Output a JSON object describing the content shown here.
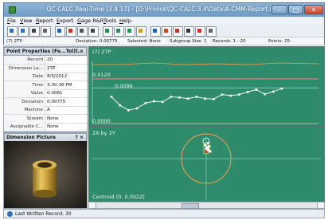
{
  "window": {
    "title": "QC-CALC Real-Time (3.4.17) - [D:\\Prolink\\QC-CALC 3.4\\Data\\A-CMM-Report.Qcc]",
    "min_label": "–",
    "max_label": "□",
    "close_label": "✕"
  },
  "menu": [
    "File",
    "View",
    "Report",
    "Export",
    "Gage R&R",
    "Tools",
    "Help"
  ],
  "toolbar": {
    "icons": [
      "open-icon",
      "save-icon",
      "print-icon",
      "preview-icon",
      "chart-icon",
      "record-icon",
      "filter-icon",
      "funnel-icon",
      "table-icon",
      "grid-icon",
      "green-chart-icon",
      "list-icon",
      "pause-icon",
      "tools-icon",
      "help-icon",
      "export-icon",
      "bars-icon",
      "settings-icon"
    ],
    "colors": [
      "#2d6fb3",
      "#2d6fb3",
      "#444444",
      "#666666",
      "#1e63b0",
      "#c0392b",
      "#555555",
      "#444444",
      "#2e8b57",
      "#2e8b57",
      "#1f9a4a",
      "#c8a21a",
      "#1e63b0",
      "#d04a1e",
      "#c0392b",
      "#333333",
      "#c0392b",
      "#666666"
    ]
  },
  "statusline": {
    "feature": "(7) 2TP",
    "deviation": "Deviation: 0.00775",
    "selected": "Selected: None",
    "subgroup": "Subgroup Size: 1",
    "records": "Records: 1 - 20",
    "points": "Points: 25"
  },
  "props": {
    "header": "Point Properties (Fe...Tol)...",
    "close": "? ×",
    "rows": [
      {
        "k": "Record",
        "v": "20"
      },
      {
        "k": "Dimension La...",
        "v": "2TP"
      },
      {
        "k": "Date",
        "v": "8/5/2012"
      },
      {
        "k": "Time",
        "v": "3:30:36 PM"
      },
      {
        "k": "Value",
        "v": "0.0081"
      },
      {
        "k": "Deviation",
        "v": "0.00775"
      },
      {
        "k": "Machine",
        "v": "A"
      },
      {
        "k": "Stream",
        "v": "None"
      },
      {
        "k": "Assignable C...",
        "v": "None"
      }
    ]
  },
  "picture": {
    "header": "Dimension Picture",
    "close": "? ×"
  },
  "chart_top": {
    "title": "(7)  2TP",
    "label_limit": "0.0120",
    "label_mid": "0.0096",
    "label_zero": "0.0000",
    "bg": "#2e8c6c"
  },
  "chart_data": [
    {
      "type": "line",
      "title": "(7) 2TP",
      "values": [
        0.0072,
        0.0049,
        0.0036,
        0.0041,
        0.0055,
        0.006,
        0.0058,
        0.0072,
        0.007,
        0.0067,
        0.0072,
        0.0067,
        0.0066,
        0.0078,
        0.0075,
        0.0078,
        0.0085,
        0.0091,
        0.0079,
        0.0086,
        0.0094
      ],
      "upper_limit": 0.012,
      "reference": 0.0096,
      "ylim": [
        0,
        0.012
      ],
      "line_color": "#ffffff",
      "limit_color": "#f08080"
    },
    {
      "type": "scatter",
      "title": "2X by 2Y",
      "points": [
        [
          0.001,
          0.0075
        ],
        [
          0.0015,
          0.006
        ],
        [
          0.001,
          0.0052
        ],
        [
          0.0,
          0.0048
        ],
        [
          0.0005,
          0.0056
        ],
        [
          0.002,
          0.0035
        ],
        [
          0.0012,
          0.0042
        ],
        [
          0.0008,
          0.0038
        ],
        [
          -0.0005,
          0.0065
        ]
      ],
      "tolerance_circle_radius": 0.012,
      "annotation": "Centroid (0, 0.0022)"
    }
  ],
  "chart_bot": {
    "title": "2X by 2Y",
    "centroid": "Centroid (0, 0.0022)"
  },
  "statusbar": {
    "text": "Last Written Record: 30"
  }
}
